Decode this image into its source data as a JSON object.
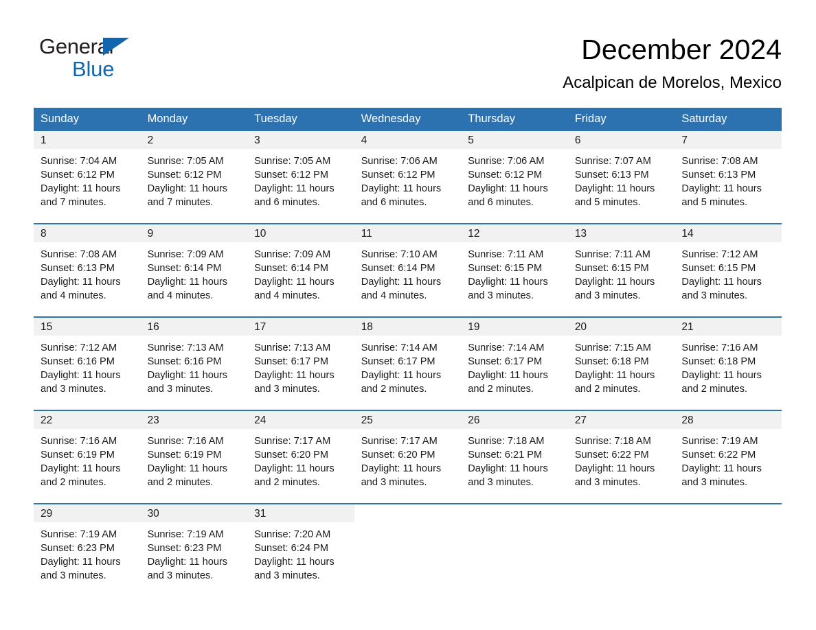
{
  "brand": {
    "name_part1": "General",
    "name_part2": "Blue",
    "triangle_color": "#1266ad"
  },
  "header": {
    "month_title": "December 2024",
    "location": "Acalpican de Morelos, Mexico",
    "accent_color": "#2c72b0",
    "daynum_bar_color": "#f1f1f1"
  },
  "weekday_headers": [
    "Sunday",
    "Monday",
    "Tuesday",
    "Wednesday",
    "Thursday",
    "Friday",
    "Saturday"
  ],
  "weeks": [
    {
      "days": [
        {
          "day": "1",
          "sunrise": "Sunrise: 7:04 AM",
          "sunset": "Sunset: 6:12 PM",
          "daylight": "Daylight: 11 hours\nand 7 minutes."
        },
        {
          "day": "2",
          "sunrise": "Sunrise: 7:05 AM",
          "sunset": "Sunset: 6:12 PM",
          "daylight": "Daylight: 11 hours\nand 7 minutes."
        },
        {
          "day": "3",
          "sunrise": "Sunrise: 7:05 AM",
          "sunset": "Sunset: 6:12 PM",
          "daylight": "Daylight: 11 hours\nand 6 minutes."
        },
        {
          "day": "4",
          "sunrise": "Sunrise: 7:06 AM",
          "sunset": "Sunset: 6:12 PM",
          "daylight": "Daylight: 11 hours\nand 6 minutes."
        },
        {
          "day": "5",
          "sunrise": "Sunrise: 7:06 AM",
          "sunset": "Sunset: 6:12 PM",
          "daylight": "Daylight: 11 hours\nand 6 minutes."
        },
        {
          "day": "6",
          "sunrise": "Sunrise: 7:07 AM",
          "sunset": "Sunset: 6:13 PM",
          "daylight": "Daylight: 11 hours\nand 5 minutes."
        },
        {
          "day": "7",
          "sunrise": "Sunrise: 7:08 AM",
          "sunset": "Sunset: 6:13 PM",
          "daylight": "Daylight: 11 hours\nand 5 minutes."
        }
      ]
    },
    {
      "days": [
        {
          "day": "8",
          "sunrise": "Sunrise: 7:08 AM",
          "sunset": "Sunset: 6:13 PM",
          "daylight": "Daylight: 11 hours\nand 4 minutes."
        },
        {
          "day": "9",
          "sunrise": "Sunrise: 7:09 AM",
          "sunset": "Sunset: 6:14 PM",
          "daylight": "Daylight: 11 hours\nand 4 minutes."
        },
        {
          "day": "10",
          "sunrise": "Sunrise: 7:09 AM",
          "sunset": "Sunset: 6:14 PM",
          "daylight": "Daylight: 11 hours\nand 4 minutes."
        },
        {
          "day": "11",
          "sunrise": "Sunrise: 7:10 AM",
          "sunset": "Sunset: 6:14 PM",
          "daylight": "Daylight: 11 hours\nand 4 minutes."
        },
        {
          "day": "12",
          "sunrise": "Sunrise: 7:11 AM",
          "sunset": "Sunset: 6:15 PM",
          "daylight": "Daylight: 11 hours\nand 3 minutes."
        },
        {
          "day": "13",
          "sunrise": "Sunrise: 7:11 AM",
          "sunset": "Sunset: 6:15 PM",
          "daylight": "Daylight: 11 hours\nand 3 minutes."
        },
        {
          "day": "14",
          "sunrise": "Sunrise: 7:12 AM",
          "sunset": "Sunset: 6:15 PM",
          "daylight": "Daylight: 11 hours\nand 3 minutes."
        }
      ]
    },
    {
      "days": [
        {
          "day": "15",
          "sunrise": "Sunrise: 7:12 AM",
          "sunset": "Sunset: 6:16 PM",
          "daylight": "Daylight: 11 hours\nand 3 minutes."
        },
        {
          "day": "16",
          "sunrise": "Sunrise: 7:13 AM",
          "sunset": "Sunset: 6:16 PM",
          "daylight": "Daylight: 11 hours\nand 3 minutes."
        },
        {
          "day": "17",
          "sunrise": "Sunrise: 7:13 AM",
          "sunset": "Sunset: 6:17 PM",
          "daylight": "Daylight: 11 hours\nand 3 minutes."
        },
        {
          "day": "18",
          "sunrise": "Sunrise: 7:14 AM",
          "sunset": "Sunset: 6:17 PM",
          "daylight": "Daylight: 11 hours\nand 2 minutes."
        },
        {
          "day": "19",
          "sunrise": "Sunrise: 7:14 AM",
          "sunset": "Sunset: 6:17 PM",
          "daylight": "Daylight: 11 hours\nand 2 minutes."
        },
        {
          "day": "20",
          "sunrise": "Sunrise: 7:15 AM",
          "sunset": "Sunset: 6:18 PM",
          "daylight": "Daylight: 11 hours\nand 2 minutes."
        },
        {
          "day": "21",
          "sunrise": "Sunrise: 7:16 AM",
          "sunset": "Sunset: 6:18 PM",
          "daylight": "Daylight: 11 hours\nand 2 minutes."
        }
      ]
    },
    {
      "days": [
        {
          "day": "22",
          "sunrise": "Sunrise: 7:16 AM",
          "sunset": "Sunset: 6:19 PM",
          "daylight": "Daylight: 11 hours\nand 2 minutes."
        },
        {
          "day": "23",
          "sunrise": "Sunrise: 7:16 AM",
          "sunset": "Sunset: 6:19 PM",
          "daylight": "Daylight: 11 hours\nand 2 minutes."
        },
        {
          "day": "24",
          "sunrise": "Sunrise: 7:17 AM",
          "sunset": "Sunset: 6:20 PM",
          "daylight": "Daylight: 11 hours\nand 2 minutes."
        },
        {
          "day": "25",
          "sunrise": "Sunrise: 7:17 AM",
          "sunset": "Sunset: 6:20 PM",
          "daylight": "Daylight: 11 hours\nand 3 minutes."
        },
        {
          "day": "26",
          "sunrise": "Sunrise: 7:18 AM",
          "sunset": "Sunset: 6:21 PM",
          "daylight": "Daylight: 11 hours\nand 3 minutes."
        },
        {
          "day": "27",
          "sunrise": "Sunrise: 7:18 AM",
          "sunset": "Sunset: 6:22 PM",
          "daylight": "Daylight: 11 hours\nand 3 minutes."
        },
        {
          "day": "28",
          "sunrise": "Sunrise: 7:19 AM",
          "sunset": "Sunset: 6:22 PM",
          "daylight": "Daylight: 11 hours\nand 3 minutes."
        }
      ]
    },
    {
      "days": [
        {
          "day": "29",
          "sunrise": "Sunrise: 7:19 AM",
          "sunset": "Sunset: 6:23 PM",
          "daylight": "Daylight: 11 hours\nand 3 minutes."
        },
        {
          "day": "30",
          "sunrise": "Sunrise: 7:19 AM",
          "sunset": "Sunset: 6:23 PM",
          "daylight": "Daylight: 11 hours\nand 3 minutes."
        },
        {
          "day": "31",
          "sunrise": "Sunrise: 7:20 AM",
          "sunset": "Sunset: 6:24 PM",
          "daylight": "Daylight: 11 hours\nand 3 minutes."
        },
        {
          "day": "",
          "sunrise": "",
          "sunset": "",
          "daylight": ""
        },
        {
          "day": "",
          "sunrise": "",
          "sunset": "",
          "daylight": ""
        },
        {
          "day": "",
          "sunrise": "",
          "sunset": "",
          "daylight": ""
        },
        {
          "day": "",
          "sunrise": "",
          "sunset": "",
          "daylight": ""
        }
      ]
    }
  ]
}
